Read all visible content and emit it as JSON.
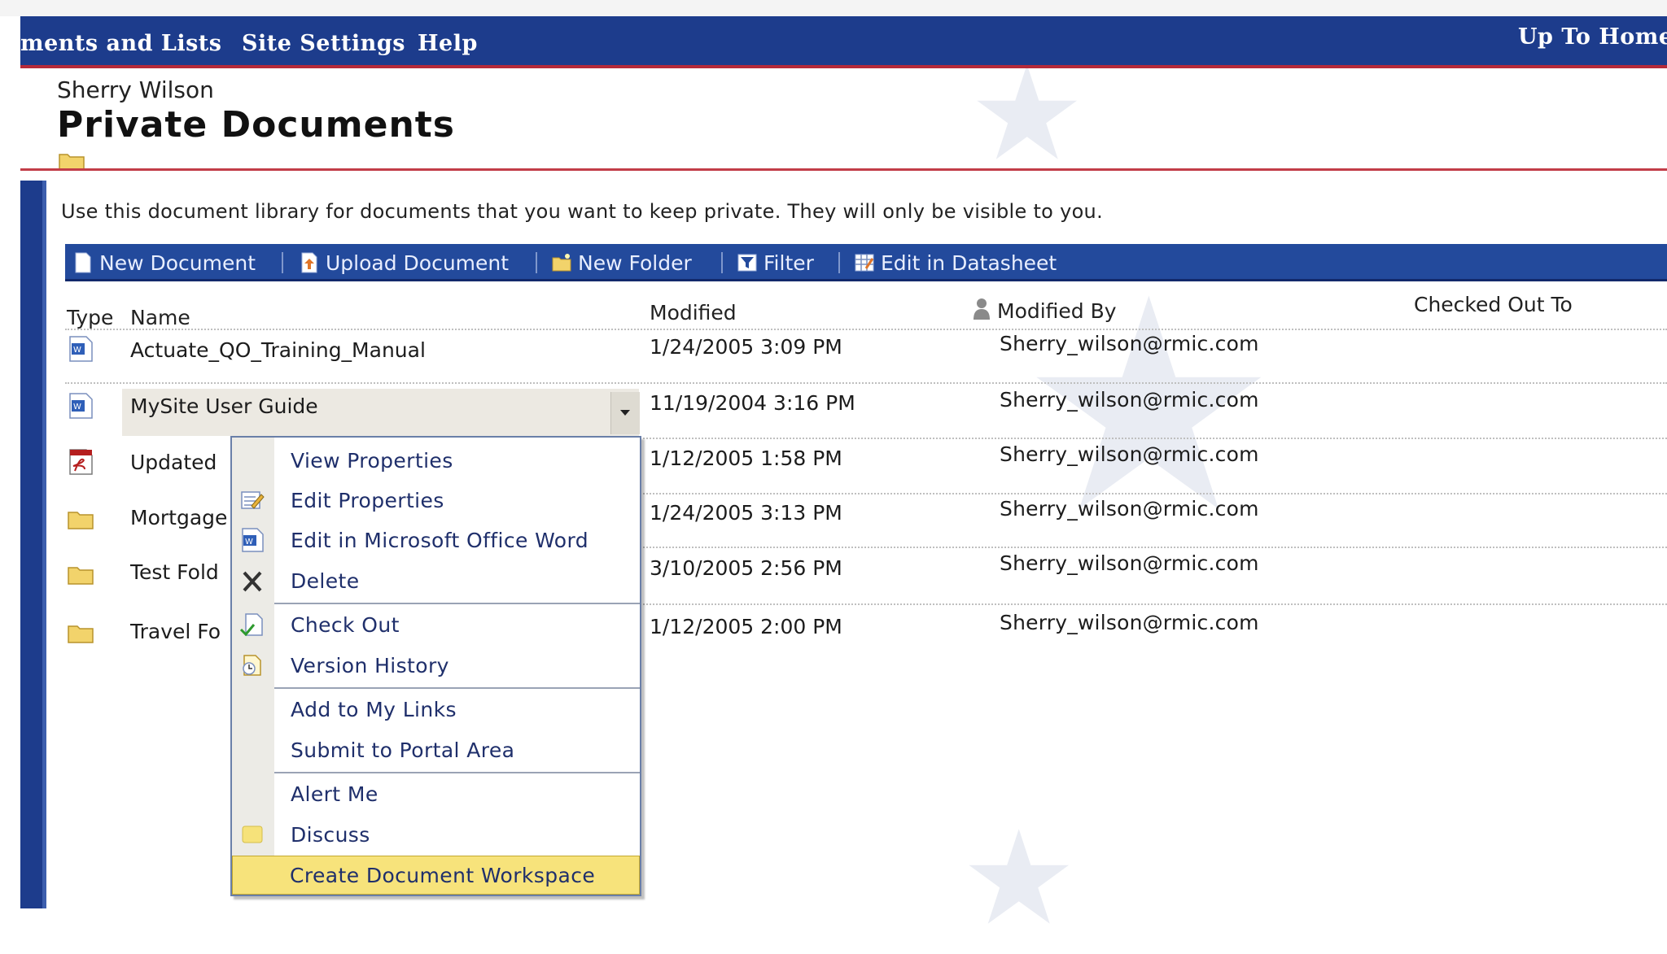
{
  "nav": {
    "items": [
      "ments and Lists",
      "Site Settings",
      "Help"
    ],
    "right_link": "Up To Home"
  },
  "site": {
    "owner": "Sherry Wilson",
    "title": "Private Documents"
  },
  "description": "Use this document library for documents that you want to keep private.  They will only be visible to you.",
  "toolbar": [
    {
      "label": "New Document",
      "icon": "new-document-icon"
    },
    {
      "label": "Upload Document",
      "icon": "upload-document-icon"
    },
    {
      "label": "New Folder",
      "icon": "new-folder-icon"
    },
    {
      "label": "Filter",
      "icon": "filter-icon"
    },
    {
      "label": "Edit in Datasheet",
      "icon": "datasheet-icon"
    }
  ],
  "columns": {
    "type": "Type",
    "name": "Name",
    "modified": "Modified",
    "modified_by": "Modified By",
    "checked_out_to": "Checked Out To"
  },
  "rows": [
    {
      "type": "word-document-icon",
      "name": "Actuate_QO_Training_Manual",
      "modified": "1/24/2005 3:09 PM",
      "modified_by": "Sherry_wilson@rmic.com"
    },
    {
      "type": "word-document-icon",
      "name": "MySite User Guide",
      "modified": "11/19/2004 3:16 PM",
      "modified_by": "Sherry_wilson@rmic.com"
    },
    {
      "type": "pdf-document-icon",
      "name": "Updated",
      "modified": "1/12/2005 1:58 PM",
      "modified_by": "Sherry_wilson@rmic.com"
    },
    {
      "type": "folder-icon",
      "name": "Mortgage",
      "modified": "1/24/2005 3:13 PM",
      "modified_by": "Sherry_wilson@rmic.com"
    },
    {
      "type": "folder-icon",
      "name": "Test Fold",
      "modified": "3/10/2005 2:56 PM",
      "modified_by": "Sherry_wilson@rmic.com"
    },
    {
      "type": "folder-icon",
      "name": "Travel Fo",
      "modified": "1/12/2005 2:00 PM",
      "modified_by": "Sherry_wilson@rmic.com"
    }
  ],
  "context_menu": [
    {
      "label": "View Properties",
      "icon": ""
    },
    {
      "label": "Edit Properties",
      "icon": "edit-properties-icon"
    },
    {
      "label": "Edit in Microsoft Office Word",
      "icon": "word-icon"
    },
    {
      "label": "Delete",
      "icon": "delete-icon"
    },
    {
      "label": "Check Out",
      "icon": "check-out-icon"
    },
    {
      "label": "Version History",
      "icon": "version-history-icon"
    },
    {
      "label": "Add to My Links",
      "icon": ""
    },
    {
      "label": "Submit to Portal Area",
      "icon": ""
    },
    {
      "label": "Alert Me",
      "icon": ""
    },
    {
      "label": "Discuss",
      "icon": "discuss-icon"
    },
    {
      "label": "Create Document Workspace",
      "icon": ""
    }
  ],
  "colors": {
    "nav_bg": "#1d3c8c",
    "accent_red": "#b52a3a",
    "toolbar_bg": "#234a9c",
    "menu_highlight": "#f7e37b"
  }
}
